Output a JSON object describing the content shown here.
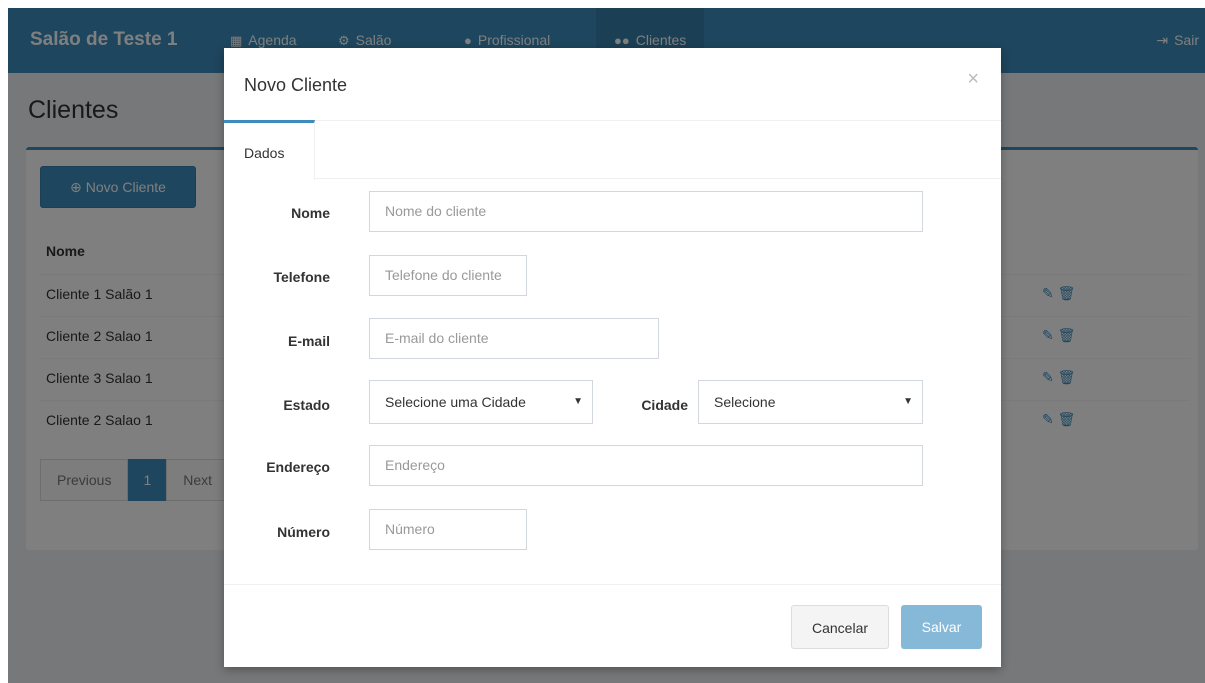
{
  "app": {
    "brand": "Salão de Teste 1",
    "logout_label": "Sair"
  },
  "nav": {
    "items": [
      {
        "icon": "calendar-icon",
        "label": "Agenda"
      },
      {
        "icon": "gears-icon",
        "label": "Salão"
      },
      {
        "icon": "user-icon",
        "label": "Profissional"
      },
      {
        "icon": "users-icon",
        "label": "Clientes"
      }
    ]
  },
  "page": {
    "title": "Clientes",
    "new_button_label": "Novo Cliente",
    "table": {
      "header": "Nome",
      "rows": [
        "Cliente 1 Salão 1",
        "Cliente 2 Salao 1",
        "Cliente 3 Salao 1",
        "Cliente 2 Salao 1"
      ]
    },
    "pagination": {
      "previous": "Previous",
      "current": "1",
      "next": "Next"
    }
  },
  "modal": {
    "title": "Novo Cliente",
    "close_label": "×",
    "tab": "Dados",
    "fields": {
      "nome": {
        "label": "Nome",
        "placeholder": "Nome do cliente"
      },
      "telefone": {
        "label": "Telefone",
        "placeholder": "Telefone do cliente"
      },
      "email": {
        "label": "E-mail",
        "placeholder": "E-mail do cliente"
      },
      "estado": {
        "label": "Estado",
        "value": "Selecione uma Cidade"
      },
      "cidade": {
        "label": "Cidade",
        "value": "Selecione"
      },
      "endereco": {
        "label": "Endereço",
        "placeholder": "Endereço"
      },
      "numero": {
        "label": "Número",
        "placeholder": "Número"
      }
    },
    "cancel_label": "Cancelar",
    "save_label": "Salvar"
  },
  "colors": {
    "primary": "#3c8dbc",
    "primary_dark": "#367fa9",
    "save_disabled": "#86b9d8",
    "background": "#ecf0f5"
  }
}
